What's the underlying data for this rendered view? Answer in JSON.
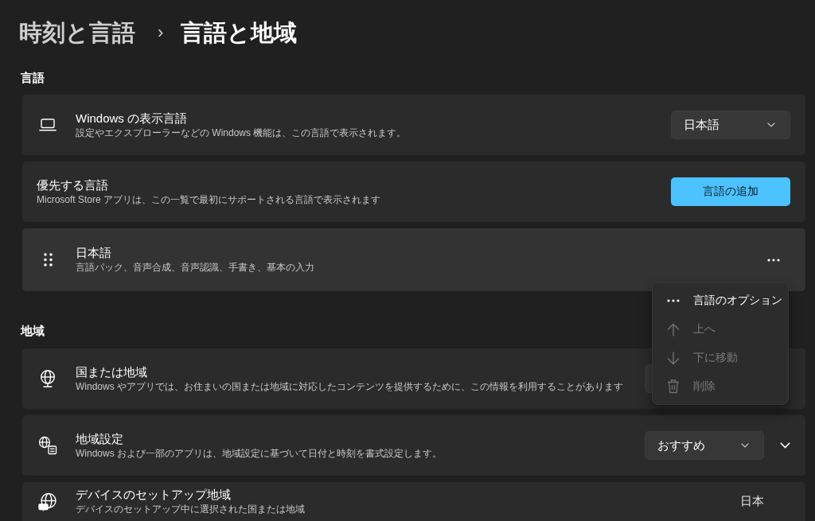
{
  "breadcrumb": {
    "parent": "時刻と言語",
    "separator": "›",
    "current": "言語と地域"
  },
  "sections": [
    {
      "heading": "言語",
      "cards": [
        {
          "title": "Windows の表示言語",
          "description": "設定やエクスプローラーなどの Windows 機能は、この言語で表示されます。",
          "highlighted": false,
          "control": {
            "kind": "dropdown",
            "value": "日本語"
          }
        },
        {
          "title": "優先する言語",
          "description": "Microsoft Store アプリは、この一覧で最初にサポートされる言語で表示されます",
          "highlighted": false,
          "control": {
            "kind": "button",
            "label": "言語の追加"
          }
        },
        {
          "title": "日本語",
          "description": "言語パック、音声合成、音声認識、手書き、基本の入力",
          "highlighted": true,
          "control": {
            "kind": "more"
          }
        }
      ]
    },
    {
      "heading": "地域",
      "cards": [
        {
          "title": "国または地域",
          "description": "Windows やアプリでは、お住まいの国または地域に対応したコンテンツを提供するために、この情報を利用することがあります",
          "highlighted": false,
          "control": {
            "kind": "dropdown"
          }
        },
        {
          "title": "地域設定",
          "description": "Windows および一部のアプリは、地域設定に基づいて日付と時刻を書式設定します。",
          "highlighted": false,
          "control": {
            "kind": "dropdown",
            "value": "おすすめ"
          },
          "expanded": false
        },
        {
          "title": "デバイスのセットアップ地域",
          "description": "デバイスのセットアップ中に選択された国または地域",
          "highlighted": false,
          "control": {
            "kind": "text",
            "value": "日本"
          }
        }
      ]
    }
  ],
  "menu": {
    "items": [
      {
        "label": "言語のオプション",
        "disabled": false
      },
      {
        "label": "上へ",
        "disabled": true
      },
      {
        "label": "下に移動",
        "disabled": true
      },
      {
        "label": "削除",
        "disabled": true
      }
    ]
  }
}
